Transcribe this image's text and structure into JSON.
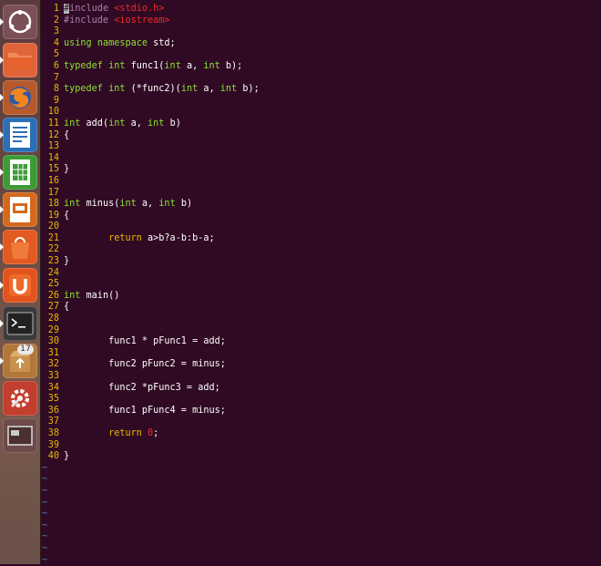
{
  "launcher": {
    "items": [
      {
        "name": "dash-home",
        "icon": "ubuntu-logo-icon",
        "color": "#7a4f55"
      },
      {
        "name": "files",
        "icon": "folder-icon",
        "color": "#e0643a"
      },
      {
        "name": "firefox",
        "icon": "firefox-icon",
        "color": "#b65a2c"
      },
      {
        "name": "libreoffice-writer",
        "icon": "writer-document-icon",
        "color": "#2b6fb5"
      },
      {
        "name": "libreoffice-calc",
        "icon": "calc-spreadsheet-icon",
        "color": "#3d9b36"
      },
      {
        "name": "libreoffice-impress",
        "icon": "impress-presentation-icon",
        "color": "#d4691e"
      },
      {
        "name": "software-center",
        "icon": "shopping-bag-icon",
        "color": "#e25a22"
      },
      {
        "name": "ubuntu-one",
        "icon": "ubuntu-one-icon",
        "color": "#e3531e"
      },
      {
        "name": "terminal",
        "icon": "terminal-icon",
        "color": "#3a3a3a"
      },
      {
        "name": "software-updater",
        "icon": "update-package-icon",
        "color": "#b4773a",
        "badge": "17"
      },
      {
        "name": "system-settings",
        "icon": "settings-tools-icon",
        "color": "#c33e2e"
      },
      {
        "name": "workspace-switcher",
        "icon": "workspace-icon",
        "color": "#6e4a4a"
      }
    ]
  },
  "editor": {
    "colors": {
      "background": "#300a24",
      "line_number": "#e8b800",
      "tilde": "#5c7ab8"
    },
    "lines": [
      {
        "n": "1",
        "tokens": [
          {
            "t": "#",
            "c": "cursor"
          },
          {
            "t": "include ",
            "c": "pre"
          },
          {
            "t": "<stdio.h>",
            "c": "str"
          }
        ]
      },
      {
        "n": "2",
        "tokens": [
          {
            "t": "#include ",
            "c": "pre"
          },
          {
            "t": "<iostream>",
            "c": "str"
          }
        ]
      },
      {
        "n": "3",
        "tokens": []
      },
      {
        "n": "4",
        "tokens": [
          {
            "t": "using",
            "c": "kw"
          },
          {
            "t": " ",
            "c": ""
          },
          {
            "t": "namespace",
            "c": "kw"
          },
          {
            "t": " std;",
            "c": ""
          }
        ]
      },
      {
        "n": "5",
        "tokens": []
      },
      {
        "n": "6",
        "tokens": [
          {
            "t": "typedef",
            "c": "kw"
          },
          {
            "t": " ",
            "c": ""
          },
          {
            "t": "int",
            "c": "type"
          },
          {
            "t": " func1(",
            "c": ""
          },
          {
            "t": "int",
            "c": "type"
          },
          {
            "t": " a, ",
            "c": ""
          },
          {
            "t": "int",
            "c": "type"
          },
          {
            "t": " b);",
            "c": ""
          }
        ]
      },
      {
        "n": "7",
        "tokens": []
      },
      {
        "n": "8",
        "tokens": [
          {
            "t": "typedef",
            "c": "kw"
          },
          {
            "t": " ",
            "c": ""
          },
          {
            "t": "int",
            "c": "type"
          },
          {
            "t": " (*func2)(",
            "c": ""
          },
          {
            "t": "int",
            "c": "type"
          },
          {
            "t": " a, ",
            "c": ""
          },
          {
            "t": "int",
            "c": "type"
          },
          {
            "t": " b);",
            "c": ""
          }
        ]
      },
      {
        "n": "9",
        "tokens": []
      },
      {
        "n": "10",
        "tokens": []
      },
      {
        "n": "11",
        "tokens": [
          {
            "t": "int",
            "c": "type"
          },
          {
            "t": " add(",
            "c": ""
          },
          {
            "t": "int",
            "c": "type"
          },
          {
            "t": " a, ",
            "c": ""
          },
          {
            "t": "int",
            "c": "type"
          },
          {
            "t": " b)",
            "c": ""
          }
        ]
      },
      {
        "n": "12",
        "tokens": [
          {
            "t": "{",
            "c": ""
          }
        ]
      },
      {
        "n": "13",
        "tokens": []
      },
      {
        "n": "14",
        "tokens": []
      },
      {
        "n": "15",
        "tokens": [
          {
            "t": "}",
            "c": ""
          }
        ]
      },
      {
        "n": "16",
        "tokens": []
      },
      {
        "n": "17",
        "tokens": []
      },
      {
        "n": "18",
        "tokens": [
          {
            "t": "int",
            "c": "type"
          },
          {
            "t": " minus(",
            "c": ""
          },
          {
            "t": "int",
            "c": "type"
          },
          {
            "t": " a, ",
            "c": ""
          },
          {
            "t": "int",
            "c": "type"
          },
          {
            "t": " b)",
            "c": ""
          }
        ]
      },
      {
        "n": "19",
        "tokens": [
          {
            "t": "{",
            "c": ""
          }
        ]
      },
      {
        "n": "20",
        "tokens": []
      },
      {
        "n": "21",
        "tokens": [
          {
            "t": "        ",
            "c": ""
          },
          {
            "t": "return",
            "c": "kw2"
          },
          {
            "t": " a>b?a-b:b-a;",
            "c": ""
          }
        ]
      },
      {
        "n": "22",
        "tokens": []
      },
      {
        "n": "23",
        "tokens": [
          {
            "t": "}",
            "c": ""
          }
        ]
      },
      {
        "n": "24",
        "tokens": []
      },
      {
        "n": "25",
        "tokens": []
      },
      {
        "n": "26",
        "tokens": [
          {
            "t": "int",
            "c": "type"
          },
          {
            "t": " main()",
            "c": ""
          }
        ]
      },
      {
        "n": "27",
        "tokens": [
          {
            "t": "{",
            "c": ""
          }
        ]
      },
      {
        "n": "28",
        "tokens": []
      },
      {
        "n": "29",
        "tokens": []
      },
      {
        "n": "30",
        "tokens": [
          {
            "t": "        func1 * pFunc1 = add;",
            "c": ""
          }
        ]
      },
      {
        "n": "31",
        "tokens": []
      },
      {
        "n": "32",
        "tokens": [
          {
            "t": "        func2 pFunc2 = minus;",
            "c": ""
          }
        ]
      },
      {
        "n": "33",
        "tokens": []
      },
      {
        "n": "34",
        "tokens": [
          {
            "t": "        func2 *pFunc3 = add;",
            "c": ""
          }
        ]
      },
      {
        "n": "35",
        "tokens": []
      },
      {
        "n": "36",
        "tokens": [
          {
            "t": "        func1 pFunc4 = minus;",
            "c": ""
          }
        ]
      },
      {
        "n": "37",
        "tokens": []
      },
      {
        "n": "38",
        "tokens": [
          {
            "t": "        ",
            "c": ""
          },
          {
            "t": "return",
            "c": "kw2"
          },
          {
            "t": " ",
            "c": ""
          },
          {
            "t": "0",
            "c": "num"
          },
          {
            "t": ";",
            "c": ""
          }
        ]
      },
      {
        "n": "39",
        "tokens": []
      },
      {
        "n": "40",
        "tokens": [
          {
            "t": "}",
            "c": ""
          }
        ]
      }
    ],
    "tildes": [
      "~",
      "~",
      "~",
      "~",
      "~",
      "~",
      "~",
      "~",
      "~"
    ]
  }
}
